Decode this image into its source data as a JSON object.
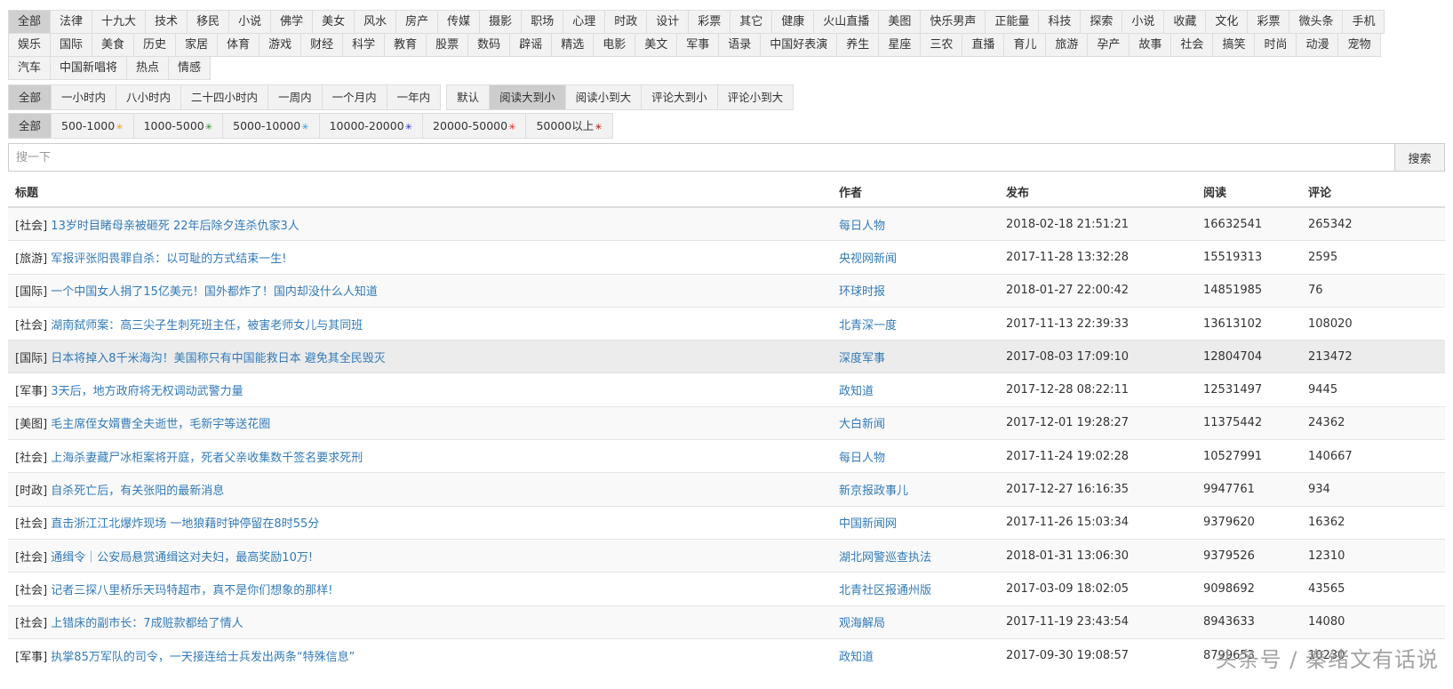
{
  "categories_row1": [
    "全部",
    "法律",
    "十九大",
    "技术",
    "移民",
    "小说",
    "佛学",
    "美女",
    "风水",
    "房产",
    "传媒",
    "摄影",
    "职场",
    "心理",
    "时政",
    "设计",
    "彩票",
    "其它",
    "健康",
    "火山直播",
    "美图",
    "快乐男声",
    "正能量",
    "科技",
    "探索",
    "小说",
    "收藏",
    "文化",
    "彩票",
    "微头条",
    "手机"
  ],
  "categories_row2": [
    "娱乐",
    "国际",
    "美食",
    "历史",
    "家居",
    "体育",
    "游戏",
    "财经",
    "科学",
    "教育",
    "股票",
    "数码",
    "辟谣",
    "精选",
    "电影",
    "美文",
    "军事",
    "语录",
    "中国好表演",
    "养生",
    "星座",
    "三农",
    "直播",
    "育儿",
    "旅游",
    "孕产",
    "故事",
    "社会",
    "搞笑",
    "时尚",
    "动漫",
    "宠物"
  ],
  "categories_row3": [
    "汽车",
    "中国新唱将",
    "热点",
    "情感"
  ],
  "time_filters": [
    "全部",
    "一小时内",
    "八小时内",
    "二十四小时内",
    "一周内",
    "一个月内",
    "一年内"
  ],
  "sort_filters": [
    "默认",
    "阅读大到小",
    "阅读小到大",
    "评论大到小",
    "评论小到大"
  ],
  "read_filters": [
    {
      "label": "全部",
      "star": "",
      "color": ""
    },
    {
      "label": "500-1000",
      "star": "✳",
      "color": "#f0a020"
    },
    {
      "label": "1000-5000",
      "star": "✳",
      "color": "#2a8a2a"
    },
    {
      "label": "5000-10000",
      "star": "✳",
      "color": "#3399dd"
    },
    {
      "label": "10000-20000",
      "star": "✳",
      "color": "#2233cc"
    },
    {
      "label": "20000-50000",
      "star": "✳",
      "color": "#dd2222"
    },
    {
      "label": "50000以上",
      "star": "✳",
      "color": "#aa1111"
    }
  ],
  "search": {
    "placeholder": "搜一下",
    "button": "搜索"
  },
  "table": {
    "headers": {
      "title": "标题",
      "author": "作者",
      "published": "发布",
      "reads": "阅读",
      "comments": "评论"
    },
    "rows": [
      {
        "cat": "[社会]",
        "title": "13岁时目睹母亲被砸死 22年后除夕连杀仇家3人",
        "author": "每日人物",
        "published": "2018-02-18 21:51:21",
        "reads": "16632541",
        "comments": "265342"
      },
      {
        "cat": "[旅游]",
        "title": "军报评张阳畏罪自杀：以可耻的方式结束一生!",
        "author": "央视网新闻",
        "published": "2017-11-28 13:32:28",
        "reads": "15519313",
        "comments": "2595"
      },
      {
        "cat": "[国际]",
        "title": "一个中国女人捐了15亿美元！国外都炸了！国内却没什么人知道",
        "author": "环球时报",
        "published": "2018-01-27 22:00:42",
        "reads": "14851985",
        "comments": "76"
      },
      {
        "cat": "[社会]",
        "title": "湖南弑师案：高三尖子生刺死班主任，被害老师女儿与其同班",
        "author": "北青深一度",
        "published": "2017-11-13 22:39:33",
        "reads": "13613102",
        "comments": "108020"
      },
      {
        "cat": "[国际]",
        "title": "日本将掉入8千米海沟！美国称只有中国能救日本 避免其全民毁灭",
        "author": "深度军事",
        "published": "2017-08-03 17:09:10",
        "reads": "12804704",
        "comments": "213472"
      },
      {
        "cat": "[军事]",
        "title": "3天后，地方政府将无权调动武警力量",
        "author": "政知道",
        "published": "2017-12-28 08:22:11",
        "reads": "12531497",
        "comments": "9445"
      },
      {
        "cat": "[美图]",
        "title": "毛主席侄女婿曹全夫逝世，毛新宇等送花圈",
        "author": "大白新闻",
        "published": "2017-12-01 19:28:27",
        "reads": "11375442",
        "comments": "24362"
      },
      {
        "cat": "[社会]",
        "title": "上海杀妻藏尸冰柜案将开庭，死者父亲收集数千签名要求死刑",
        "author": "每日人物",
        "published": "2017-11-24 19:02:28",
        "reads": "10527991",
        "comments": "140667"
      },
      {
        "cat": "[时政]",
        "title": "自杀死亡后，有关张阳的最新消息",
        "author": "新京报政事儿",
        "published": "2017-12-27 16:16:35",
        "reads": "9947761",
        "comments": "934"
      },
      {
        "cat": "[社会]",
        "title": "直击浙江江北爆炸现场 一地狼藉时钟停留在8时55分",
        "author": "中国新闻网",
        "published": "2017-11-26 15:03:34",
        "reads": "9379620",
        "comments": "16362"
      },
      {
        "cat": "[社会]",
        "title": "通缉令｜公安局悬赏通缉这对夫妇，最高奖励10万!",
        "author": "湖北网警巡查执法",
        "published": "2018-01-31 13:06:30",
        "reads": "9379526",
        "comments": "12310"
      },
      {
        "cat": "[社会]",
        "title": "记者三探八里桥乐天玛特超市，真不是你们想象的那样!",
        "author": "北青社区报通州版",
        "published": "2017-03-09 18:02:05",
        "reads": "9098692",
        "comments": "43565"
      },
      {
        "cat": "[社会]",
        "title": "上错床的副市长：7成赃款都给了情人",
        "author": "观海解局",
        "published": "2017-11-19 23:43:54",
        "reads": "8943633",
        "comments": "14080"
      },
      {
        "cat": "[军事]",
        "title": "执掌85万军队的司令，一天接连给士兵发出两条“特殊信息”",
        "author": "政知道",
        "published": "2017-09-30 19:08:57",
        "reads": "8799653",
        "comments": "10230"
      }
    ]
  },
  "watermark": "头条号 / 秦绪文有话说"
}
